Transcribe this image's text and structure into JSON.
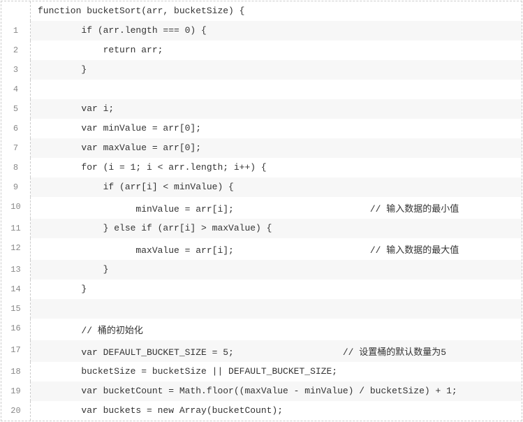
{
  "code": {
    "lines": [
      {
        "num": "",
        "text": "function bucketSort(arr, bucketSize) {"
      },
      {
        "num": "1",
        "text": "        if (arr.length === 0) {"
      },
      {
        "num": "2",
        "text": "            return arr;"
      },
      {
        "num": "3",
        "text": "        }"
      },
      {
        "num": "4",
        "text": " "
      },
      {
        "num": "5",
        "text": "        var i;"
      },
      {
        "num": "6",
        "text": "        var minValue = arr[0];"
      },
      {
        "num": "7",
        "text": "        var maxValue = arr[0];"
      },
      {
        "num": "8",
        "text": "        for (i = 1; i < arr.length; i++) {"
      },
      {
        "num": "9",
        "text": "            if (arr[i] < minValue) {"
      },
      {
        "num": "10",
        "text": "                  minValue = arr[i];                         // 输入数据的最小值"
      },
      {
        "num": "11",
        "text": "            } else if (arr[i] > maxValue) {"
      },
      {
        "num": "12",
        "text": "                  maxValue = arr[i];                         // 输入数据的最大值"
      },
      {
        "num": "13",
        "text": "            }"
      },
      {
        "num": "14",
        "text": "        }"
      },
      {
        "num": "15",
        "text": " "
      },
      {
        "num": "16",
        "text": "        // 桶的初始化"
      },
      {
        "num": "17",
        "text": "        var DEFAULT_BUCKET_SIZE = 5;                    // 设置桶的默认数量为5"
      },
      {
        "num": "18",
        "text": "        bucketSize = bucketSize || DEFAULT_BUCKET_SIZE;"
      },
      {
        "num": "19",
        "text": "        var bucketCount = Math.floor((maxValue - minValue) / bucketSize) + 1; "
      },
      {
        "num": "20",
        "text": "        var buckets = new Array(bucketCount);"
      }
    ]
  }
}
